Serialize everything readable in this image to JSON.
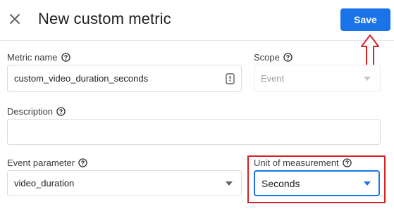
{
  "header": {
    "title": "New custom metric",
    "save_label": "Save"
  },
  "form": {
    "metric_name": {
      "label": "Metric name",
      "value": "custom_video_duration_seconds"
    },
    "scope": {
      "label": "Scope",
      "value": "Event"
    },
    "description": {
      "label": "Description",
      "value": ""
    },
    "event_parameter": {
      "label": "Event parameter",
      "value": "video_duration"
    },
    "unit_of_measurement": {
      "label": "Unit of measurement",
      "value": "Seconds"
    }
  },
  "icons": [
    "close-icon",
    "help-icon",
    "badge-icon",
    "dropdown-arrow-icon",
    "annotation-arrow-icon"
  ],
  "colors": {
    "accent": "#1a73e8",
    "annotation": "#d4222a",
    "text": "#202124",
    "disabled_text": "#9aa0a6"
  }
}
